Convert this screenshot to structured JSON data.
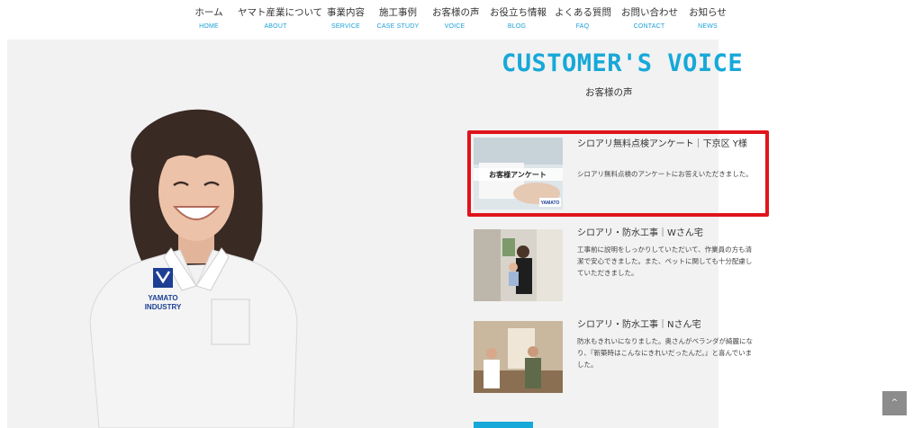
{
  "nav": [
    {
      "jp": "ホーム",
      "en": "HOME"
    },
    {
      "jp": "ヤマト産業について",
      "en": "ABOUT"
    },
    {
      "jp": "事業内容",
      "en": "SERVICE"
    },
    {
      "jp": "施工事例",
      "en": "CASE STUDY"
    },
    {
      "jp": "お客様の声",
      "en": "VOICE"
    },
    {
      "jp": "お役立ち情報",
      "en": "BLOG"
    },
    {
      "jp": "よくある質問",
      "en": "FAQ"
    },
    {
      "jp": "お問い合わせ",
      "en": "CONTACT"
    },
    {
      "jp": "お知らせ",
      "en": "NEWS"
    }
  ],
  "section": {
    "title": "CUSTOMER'S VOICE",
    "subtitle": "お客様の声"
  },
  "hero": {
    "shirt_logo_line1": "YAMATO",
    "shirt_logo_line2": "INDUSTRY"
  },
  "cards": [
    {
      "title": "シロアリ無料点検アンケート｜下京区 Y様",
      "body": "シロアリ無料点検のアンケートにお答えいただきました。",
      "thumb_caption": "お客様アンケート",
      "thumb_logo": "YAMATO"
    },
    {
      "title": "シロアリ・防水工事｜Wさん宅",
      "body": "工事前に説明をしっかりしていただいて、作業員の方も清潔で安心できました。また、ペットに関しても十分配慮していただきました。"
    },
    {
      "title": "シロアリ・防水工事｜Nさん宅",
      "body": "防水もきれいになりました。奥さんがベランダが綺麗になり、『新築時はこんなにきれいだったんだ。』と喜んでいました。"
    }
  ],
  "scroll_top": {
    "icon": "chevron-up-icon",
    "label": "^"
  },
  "colors": {
    "accent": "#16a8d8",
    "highlight": "#e0141b",
    "hero_bg": "#f2f2f2"
  }
}
